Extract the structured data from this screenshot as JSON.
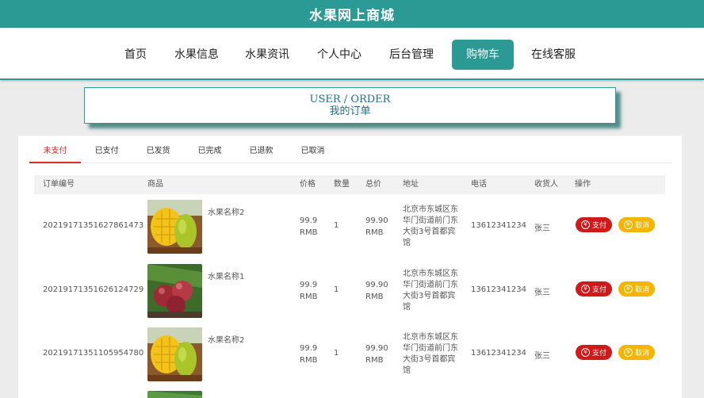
{
  "site": {
    "title": "水果网上商城"
  },
  "nav": {
    "items": [
      {
        "label": "首页"
      },
      {
        "label": "水果信息"
      },
      {
        "label": "水果资讯"
      },
      {
        "label": "个人中心"
      },
      {
        "label": "后台管理"
      },
      {
        "label": "购物车",
        "active": true
      },
      {
        "label": "在线客服"
      }
    ]
  },
  "banner": {
    "en": "USER / ORDER",
    "zh": "我的订单"
  },
  "tabs": [
    {
      "label": "未支付",
      "active": true
    },
    {
      "label": "已支付"
    },
    {
      "label": "已发货"
    },
    {
      "label": "已完成"
    },
    {
      "label": "已退款"
    },
    {
      "label": "已取消"
    }
  ],
  "table": {
    "headers": [
      "订单编号",
      "商品",
      "价格",
      "数量",
      "总价",
      "地址",
      "电话",
      "收货人",
      "操作"
    ],
    "pay_label": "支付",
    "cancel_label": "取消",
    "currency_icon": "¥",
    "rows": [
      {
        "order_no": "20219171351627861473",
        "goods": "水果名称2",
        "image": "mango",
        "price": "99.9",
        "price_unit": "RMB",
        "qty": "1",
        "total": "99.90",
        "total_unit": "RMB",
        "address": "北京市东城区东华门街道前门东大街3号首都宾馆",
        "phone": "13612341234",
        "receiver": "张三"
      },
      {
        "order_no": "20219171351626124729",
        "goods": "水果名称1",
        "image": "plum",
        "price": "99.9",
        "price_unit": "RMB",
        "qty": "1",
        "total": "99.90",
        "total_unit": "RMB",
        "address": "北京市东城区东华门街道前门东大街3号首都宾馆",
        "phone": "13612341234",
        "receiver": "张三"
      },
      {
        "order_no": "20219171351105954780",
        "goods": "水果名称2",
        "image": "mango",
        "price": "99.9",
        "price_unit": "RMB",
        "qty": "1",
        "total": "99.90",
        "total_unit": "RMB",
        "address": "北京市东城区东华门街道前门东大街3号首都宾馆",
        "phone": "13612341234",
        "receiver": "张三"
      }
    ]
  },
  "colors": {
    "accent": "#2b9a94",
    "active_tab": "#d42b2b",
    "pay": "#d01919",
    "cancel": "#f4b400"
  }
}
